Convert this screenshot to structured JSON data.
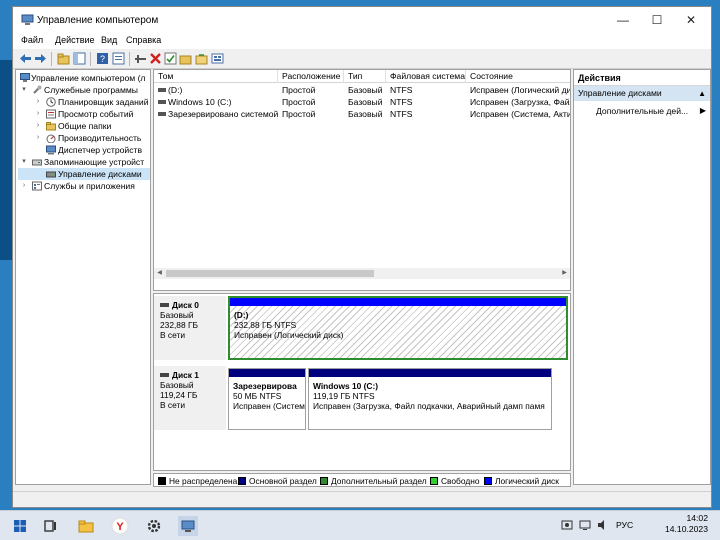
{
  "window": {
    "title": "Управление компьютером",
    "controls": {
      "minimize": "—",
      "maximize": "☐",
      "close": "✕"
    }
  },
  "menu": [
    "Файл",
    "Действие",
    "Вид",
    "Справка"
  ],
  "tree": [
    {
      "label": "Управление компьютером (л",
      "arrow": "▾",
      "icon": "computer-management-icon"
    },
    {
      "label": "Служебные программы",
      "arrow": "▾",
      "icon": "tools-icon"
    },
    {
      "label": "Планировщик заданий",
      "arrow": "›",
      "icon": "clock-icon"
    },
    {
      "label": "Просмотр событий",
      "arrow": "›",
      "icon": "event-viewer-icon"
    },
    {
      "label": "Общие папки",
      "arrow": "›",
      "icon": "shared-folder-icon"
    },
    {
      "label": "Производительность",
      "arrow": "›",
      "icon": "performance-icon"
    },
    {
      "label": "Диспетчер устройств",
      "arrow": "",
      "icon": "device-manager-icon"
    },
    {
      "label": "Запоминающие устройст",
      "arrow": "▾",
      "icon": "storage-icon"
    },
    {
      "label": "Управление дисками",
      "arrow": "",
      "icon": "disk-icon",
      "selected": true
    },
    {
      "label": "Службы и приложения",
      "arrow": "›",
      "icon": "services-icon"
    }
  ],
  "volumes": {
    "columns": [
      "Том",
      "Расположение",
      "Тип",
      "Файловая система",
      "Состояние"
    ],
    "rows": [
      [
        "(D:)",
        "Простой",
        "Базовый",
        "NTFS",
        "Исправен (Логический ди"
      ],
      [
        "Windows 10 (C:)",
        "Простой",
        "Базовый",
        "NTFS",
        "Исправен (Загрузка, Файл"
      ],
      [
        "Зарезервировано системой",
        "Простой",
        "Базовый",
        "NTFS",
        "Исправен (Система, Акти"
      ]
    ]
  },
  "disks": [
    {
      "name": "Диск 0",
      "type": "Базовый",
      "size": "232,88 ГБ",
      "status": "В сети",
      "partitions": [
        {
          "name": "(D:)",
          "size": "232,88 ГБ NTFS",
          "status": "Исправен (Логический диск)"
        }
      ]
    },
    {
      "name": "Диск 1",
      "type": "Базовый",
      "size": "119,24 ГБ",
      "status": "В сети",
      "partitions": [
        {
          "name": "Зарезервирова",
          "size": "50 МБ NTFS",
          "status": "Исправен (Систем"
        },
        {
          "name": "Windows 10  (C:)",
          "size": "119,19 ГБ NTFS",
          "status": "Исправен (Загрузка, Файл подкачки, Аварийный дамп памя"
        }
      ]
    }
  ],
  "legend": [
    {
      "label": "Не распределена",
      "color": "#000000"
    },
    {
      "label": "Основной раздел",
      "color": "#00007f"
    },
    {
      "label": "Дополнительный раздел",
      "color": "#2e8b2e"
    },
    {
      "label": "Свободно",
      "color": "#33cc33"
    },
    {
      "label": "Логический диск",
      "color": "#0000ff"
    }
  ],
  "actions": {
    "title": "Действия",
    "section": "Управление дисками",
    "item": "Дополнительные дей..."
  },
  "taskbar": {
    "tray_lang": "РУС",
    "time": "14:02",
    "date": "14.10.2023"
  },
  "colors": {
    "primary_partition": "#00007f",
    "logical_disk": "#0000ff",
    "selection": "#2f8d2f"
  }
}
